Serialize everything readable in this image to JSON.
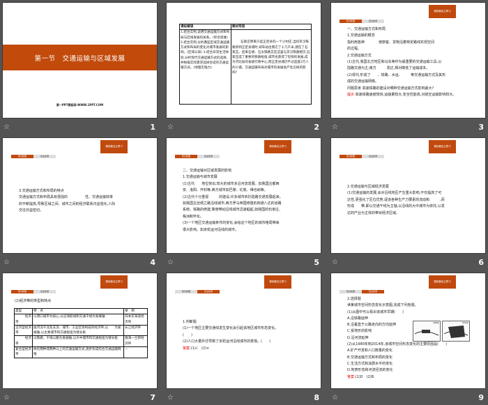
{
  "slides": [
    {
      "number": "1",
      "title": "第一节　交通运输与区域发展",
      "footer": "第一PPT模板网-WWW.1PPT.COM"
    },
    {
      "number": "2",
      "table_headers": [
        "课标解读",
        "教材导思"
      ],
      "left_text": "1.结合实例,说明交通运输方式和布局与区域发展的关系。(综合思维) 2.结合实例,分析典型区域交通运输方式和布局的变化对城市发展的影响。(区域认知) 3.结合日常生活体验,分析现代交通运输方式的选择,并根据实际需求选择合适的交通运输方式。(地理实践力)",
      "right_text": "石家庄原来只是正定县的一个小村庄,当初京汉铁路修到正定县城时,却车站往南迁了十几千米,建在了石家庄。后来石德、石太铁路又在这里与京汉铁路相交,石家庄成了重要的铁路枢纽,城市也获得了较快的发展,成为河北省的省级行政中心,而正定县城仍不过是座3万人的小城。交通运输布局对城市的发展会产生怎样的影响?"
    },
    {
      "number": "3",
      "badge": "课前篇自主预习",
      "tabs": [
        "知识梳理",
        "自主检测"
      ],
      "lines": [
        "一、交通运输方式和布局",
        "1.交通运输的概念",
        "指利用各种　　　　使旅客、货物沿着特定路线实现空间",
        "的过程。",
        "2.交通运输方式",
        "(1)古代,我国北方地区和马车等作为最重要的交通运输工具,以",
        "陆路交通为主;南方　　　发达,相对降低了运输成本。",
        "(2)现代,形成了　　、铁路、水运、　　　等交通运输方式及其形",
        "成的交通运输网络。",
        "问题思考 高速铁路的建设对哪种交通运输方式影响最大?"
      ],
      "hint_label": "提示",
      "hint_text": "高速铁路速度较快,运输量较大,安全性能高,对航空运输影响较大。"
    },
    {
      "number": "4",
      "badge": "课前篇自主预习",
      "tabs": [
        "知识梳理",
        "自主检测"
      ],
      "lines": [
        "3.交通运输方式和布局的特点",
        "交通运输方式和布局具有很强的　　　　　性。交通运输效率",
        "的不断提高,导致区域之间、城市之间的经济联系日益强化,人际",
        "交往日益密切。"
      ]
    },
    {
      "number": "5",
      "badge": "课前篇自主预习",
      "tabs": [
        "知识梳理",
        "自主检测"
      ],
      "lines": [
        "二、交通运输对区域发展的影响",
        "1.交通运输与城市发展",
        "(1)古代　　地位突出,较大的城市多沿河流发展。如我国古都西",
        "安、洛阳、开封等,西方城市如巴黎、伦敦、维也纳等。",
        "(2)古代十分重视　　　的建设,许多城市依托陆路交通发展起来。",
        "如我国古丝绸之路沿线城市,西方罗马帝国修建的四通八达的道路",
        "系统。铁路的修建,致使带动沿线城市迅速崛起,如我国的石家庄、",
        "株洲和怀化。",
        "(3)一个地区交通运输条件的变化,会给这个地区的城市格局带来",
        "很大影响。如京杭运河沿线的城市。"
      ]
    },
    {
      "number": "6",
      "badge": "课前篇自主预习",
      "tabs": [
        "知识梳理",
        "自主检测"
      ],
      "lines": [
        "2.交通运输与区域经济发展",
        "(1)交通运输的发展,会对沿线地区产生重大影响,不仅提高了可",
        "达性,更强化了区位优势,促进各种生产力要素的流动和　　　,而",
        "形成　　带,即以交通干线为主轴,以沿线的大中城市为依托,以发",
        "达的产业为主体的带状经济区域。"
      ]
    },
    {
      "number": "7",
      "badge": "课前篇自主预习",
      "tabs": [
        "知识梳理",
        "自主检测"
      ],
      "intro": "(2)经济带的类型和特点",
      "table": {
        "headers": [
          "类型",
          "特　点",
          "举　例"
        ],
        "rows": [
          [
            "　　　经济带",
            "以港口城市为核心,以沿海航线和交通干线为发展轴",
            "日本东海道经济带"
          ],
          [
            "沿河型经济带",
            "由河流干流及支流、城市、工业区等构成的经济带,以　　为发展轴,以主要城市和交通枢纽为增长极",
            "长江经济带"
          ],
          [
            "　　　经济带",
            "以铁路、干线公路为发展轴,以大中城市和交通枢纽为增长极",
            "陇海一兰新经济带"
          ],
          [
            "复合型经济带",
            "依托两种或两种以上的交通运输方式,逐步形成综合交通运输网络",
            "—"
          ]
        ]
      }
    },
    {
      "number": "8",
      "badge": "课前篇自主预习",
      "tabs": [
        "知识梳理",
        "自主检测"
      ],
      "lines": [
        "1.判断题",
        "(1)一个地区主要交通线发生变化会引起该地区城市形态变化。",
        "(　　)",
        "(2)人口大量外迁导致了京杭运河沿线城市的衰落。(　　)"
      ],
      "answer_label": "答案",
      "answer_text": ":(1)√　(2)×"
    },
    {
      "number": "9",
      "badge": "课前篇自主预习",
      "tabs": [
        "知识梳理",
        "自主检测"
      ],
      "lines": [
        "2.选择题",
        "读某城市空间形态变化示意图,完成下列各题。",
        "(1)从图中可以看出该城市早期(　　)",
        "A.沿铁路延伸",
        "B.沿垂直于公路走向的方向延伸",
        "C.受地形的影响",
        "D.沿河流延伸",
        "(2)从1980年到2014年,该城市空间形态变化的主要原因是(　　)",
        "A.矿产开发和人口数量的变化",
        "B.交通运输方式和布局的变化",
        "C.生活方式和消费水平的变化",
        "D.地表形态和河流径流的变化"
      ],
      "answer_label": "答案",
      "answer_text": ":(1)D　(2)B",
      "map_years": [
        "1980年",
        "2014年"
      ]
    }
  ]
}
